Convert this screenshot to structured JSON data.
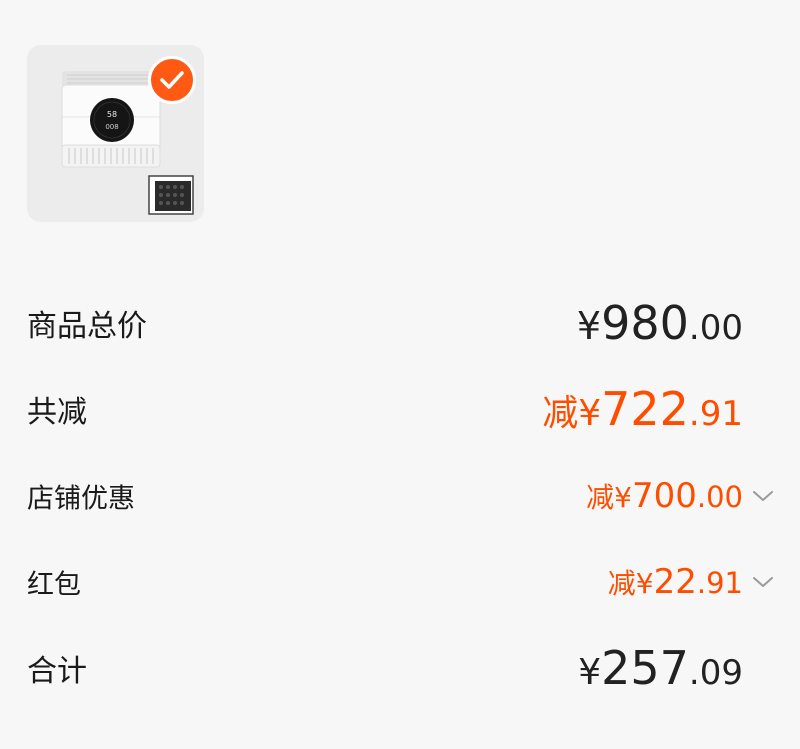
{
  "product": {
    "image": "air-purifier-image",
    "selected": true,
    "display_reading": "58",
    "display_reading_2": "008"
  },
  "summary": {
    "total_label": "商品总价",
    "total_symbol": "¥",
    "total_int": "980",
    "total_dec": ".00",
    "discount_label": "共减",
    "discount_prefix": "减",
    "discount_symbol": "¥",
    "discount_int": "722",
    "discount_dec": ".91",
    "shop_label": "店铺优惠",
    "shop_prefix": "减",
    "shop_symbol": "¥",
    "shop_int": "700",
    "shop_dec": ".00",
    "redpacket_label": "红包",
    "redpacket_prefix": "减",
    "redpacket_symbol": "¥",
    "redpacket_int": "22",
    "redpacket_dec": ".91",
    "grand_label": "合计",
    "grand_symbol": "¥",
    "grand_int": "257",
    "grand_dec": ".09"
  },
  "colors": {
    "accent": "#ff4d00",
    "check_bg": "#ff5a13",
    "text": "#222222",
    "background": "#f7f7f7"
  },
  "icons": [
    "check-icon",
    "chevron-down-icon"
  ]
}
